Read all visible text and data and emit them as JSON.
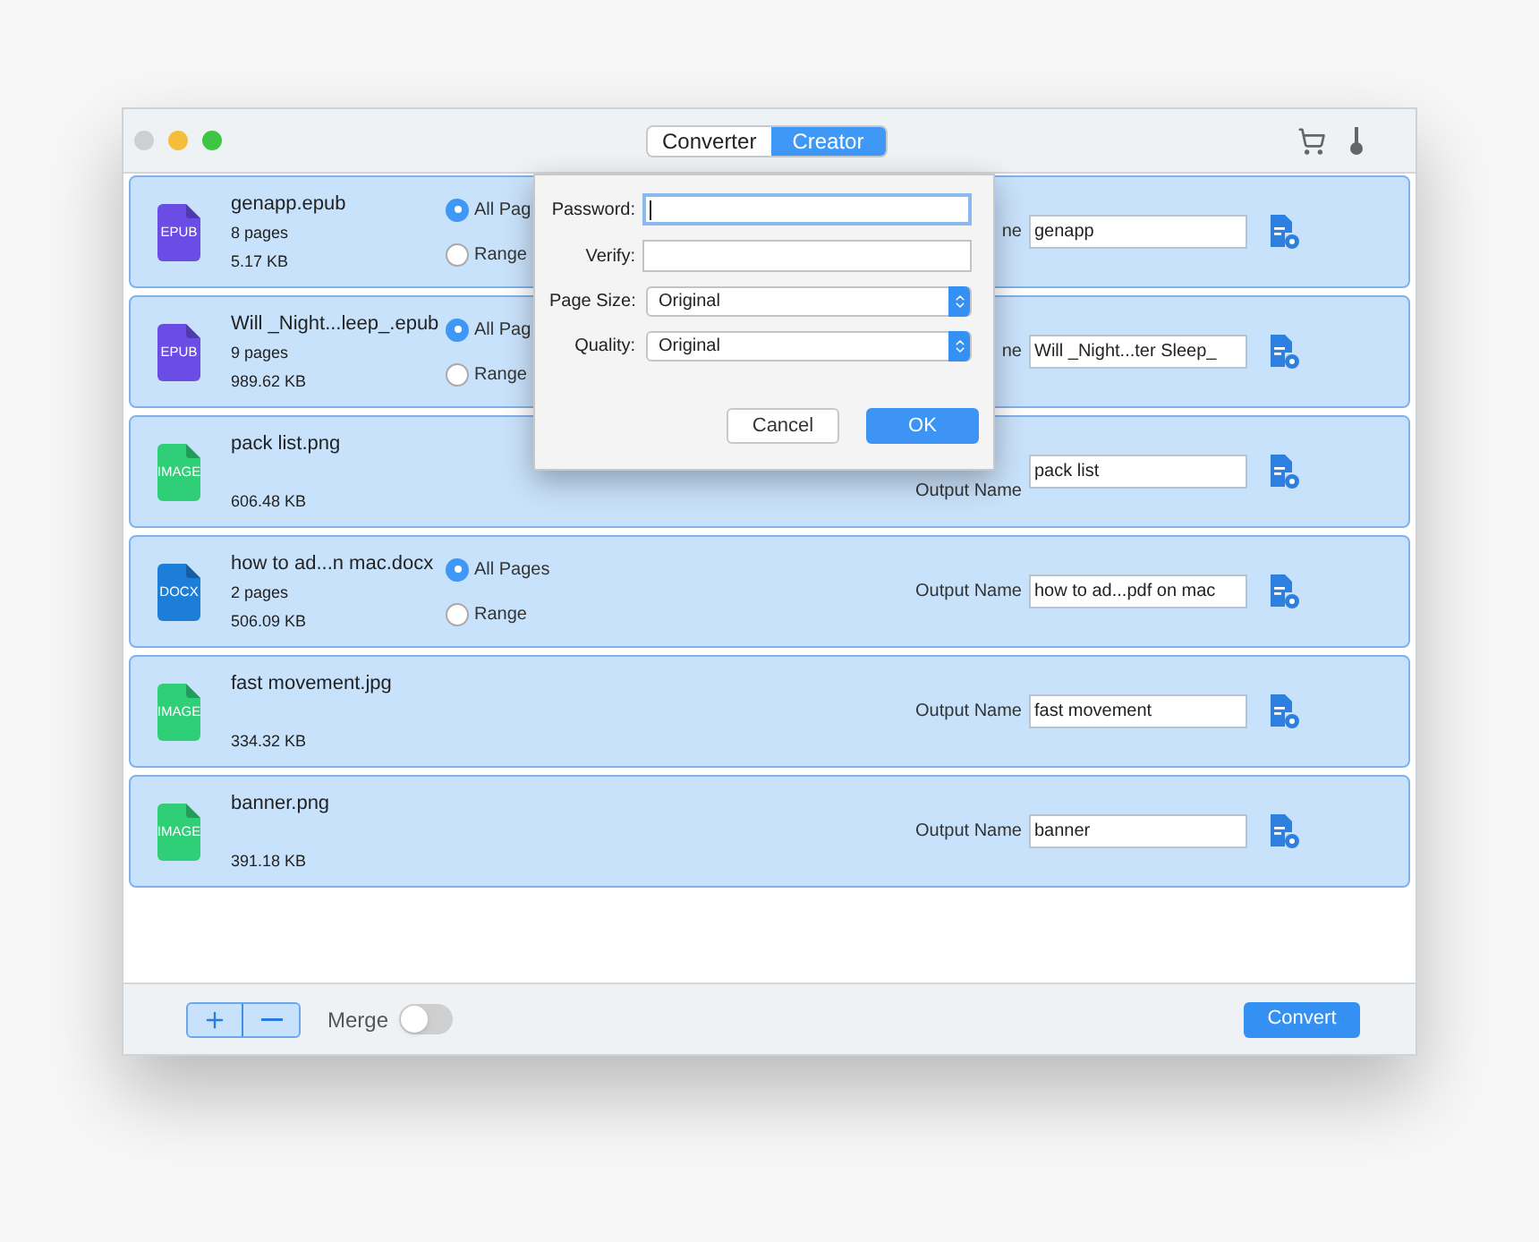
{
  "tabs": [
    {
      "label": "Converter",
      "selected": false
    },
    {
      "label": "Creator",
      "selected": true
    }
  ],
  "files": [
    {
      "type": "EPUB",
      "color": "#6b4de6",
      "name": "genapp.epub",
      "pages": "8 pages",
      "size": "5.17 KB",
      "options": [
        {
          "label": "All Pag",
          "selected": true
        },
        {
          "label": "Range",
          "selected": false
        }
      ],
      "output_label": "ne",
      "output_name": "genapp"
    },
    {
      "type": "EPUB",
      "color": "#6b4de6",
      "name": "Will _Night...leep_.epub",
      "pages": "9 pages",
      "size": "989.62 KB",
      "options": [
        {
          "label": "All Pag",
          "selected": true
        },
        {
          "label": "Range",
          "selected": false
        }
      ],
      "output_label": "ne",
      "output_name": "Will _Night...ter Sleep_"
    },
    {
      "type": "IMAGE",
      "color": "#2fcf78",
      "name": "pack list.png",
      "size": "606.48 KB",
      "output_label": "Output Name",
      "output_name": "pack list"
    },
    {
      "type": "DOCX",
      "color": "#1d7ed8",
      "name": "how to ad...n mac.docx",
      "pages": "2 pages",
      "size": "506.09 KB",
      "options": [
        {
          "label": "All Pages",
          "selected": true
        },
        {
          "label": "Range",
          "selected": false
        }
      ],
      "output_label": "Output Name",
      "output_name": "how to ad...pdf on mac"
    },
    {
      "type": "IMAGE",
      "color": "#2fcf78",
      "name": "fast movement.jpg",
      "size": "334.32 KB",
      "output_label": "Output Name",
      "output_name": "fast movement"
    },
    {
      "type": "IMAGE",
      "color": "#2fcf78",
      "name": "banner.png",
      "size": "391.18 KB",
      "output_label": "Output Name",
      "output_name": "banner"
    }
  ],
  "dialog": {
    "fields": [
      {
        "kind": "text",
        "label": "Password:",
        "focused": true
      },
      {
        "kind": "text",
        "label": "Verify:",
        "focused": false
      },
      {
        "kind": "select",
        "label": "Page Size:",
        "value": "Original"
      },
      {
        "kind": "select",
        "label": "Quality:",
        "value": "Original"
      }
    ],
    "buttons": [
      {
        "label": "Cancel",
        "primary": false
      },
      {
        "label": "OK",
        "primary": true
      }
    ]
  },
  "footer": {
    "merge": {
      "label": "Merge",
      "on": false
    },
    "convert": "Convert"
  }
}
